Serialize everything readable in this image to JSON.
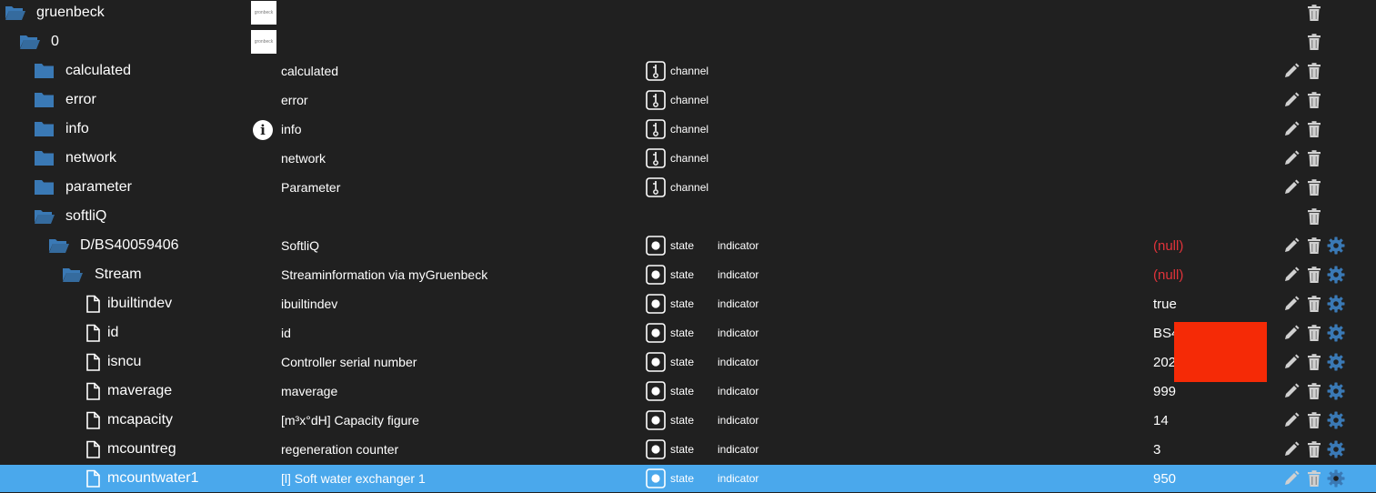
{
  "colors": {
    "background": "#202020",
    "selected_row": "#4aa8ec",
    "folder": "#3a79b5",
    "null_value": "#e0333a",
    "redaction": "#f52a06",
    "settings_icon": "#3a79b5"
  },
  "rows": [
    {
      "name": "gruenbeck",
      "description": "",
      "logo": "gronbeck",
      "type": "",
      "role": "",
      "value": "",
      "node_icon": "folder-open-icon"
    },
    {
      "name": "0",
      "description": "",
      "logo": "gronbeck",
      "type": "",
      "role": "",
      "value": "",
      "node_icon": "folder-open-icon"
    },
    {
      "name": "calculated",
      "description": "calculated",
      "type": "channel",
      "role": "",
      "value": "",
      "node_icon": "folder-icon"
    },
    {
      "name": "error",
      "description": "error",
      "type": "channel",
      "role": "",
      "value": "",
      "node_icon": "folder-icon"
    },
    {
      "name": "info",
      "description": "info",
      "info_icon": "i",
      "type": "channel",
      "role": "",
      "value": "",
      "node_icon": "folder-icon"
    },
    {
      "name": "network",
      "description": "network",
      "type": "channel",
      "role": "",
      "value": "",
      "node_icon": "folder-icon"
    },
    {
      "name": "parameter",
      "description": "Parameter",
      "type": "channel",
      "role": "",
      "value": "",
      "node_icon": "folder-icon"
    },
    {
      "name": "softliQ",
      "description": "",
      "type": "",
      "role": "",
      "value": "",
      "node_icon": "folder-open-icon"
    },
    {
      "name": "D/BS40059406",
      "description": "SoftliQ",
      "type": "state",
      "role": "indicator",
      "value": "(null)",
      "node_icon": "folder-open-icon"
    },
    {
      "name": "Stream",
      "description": "Streaminformation via myGruenbeck",
      "type": "state",
      "role": "indicator",
      "value": "(null)",
      "node_icon": "folder-open-icon"
    },
    {
      "name": "ibuiltindev",
      "description": "ibuiltindev",
      "type": "state",
      "role": "indicator",
      "value": "true",
      "node_icon": "file-icon"
    },
    {
      "name": "id",
      "description": "id",
      "type": "state",
      "role": "indicator",
      "value": "BS4",
      "node_icon": "file-icon"
    },
    {
      "name": "isncu",
      "description": "Controller serial number",
      "type": "state",
      "role": "indicator",
      "value": "202",
      "node_icon": "file-icon"
    },
    {
      "name": "maverage",
      "description": "maverage",
      "type": "state",
      "role": "indicator",
      "value": "999",
      "node_icon": "file-icon"
    },
    {
      "name": "mcapacity",
      "description": "[m³x°dH] Capacity figure",
      "type": "state",
      "role": "indicator",
      "value": "14",
      "node_icon": "file-icon"
    },
    {
      "name": "mcountreg",
      "description": "regeneration counter",
      "type": "state",
      "role": "indicator",
      "value": "3",
      "node_icon": "file-icon"
    },
    {
      "name": "mcountwater1",
      "description": "[l] Soft water exchanger 1",
      "type": "state",
      "role": "indicator",
      "value": "950",
      "node_icon": "file-icon",
      "selected": true
    }
  ]
}
